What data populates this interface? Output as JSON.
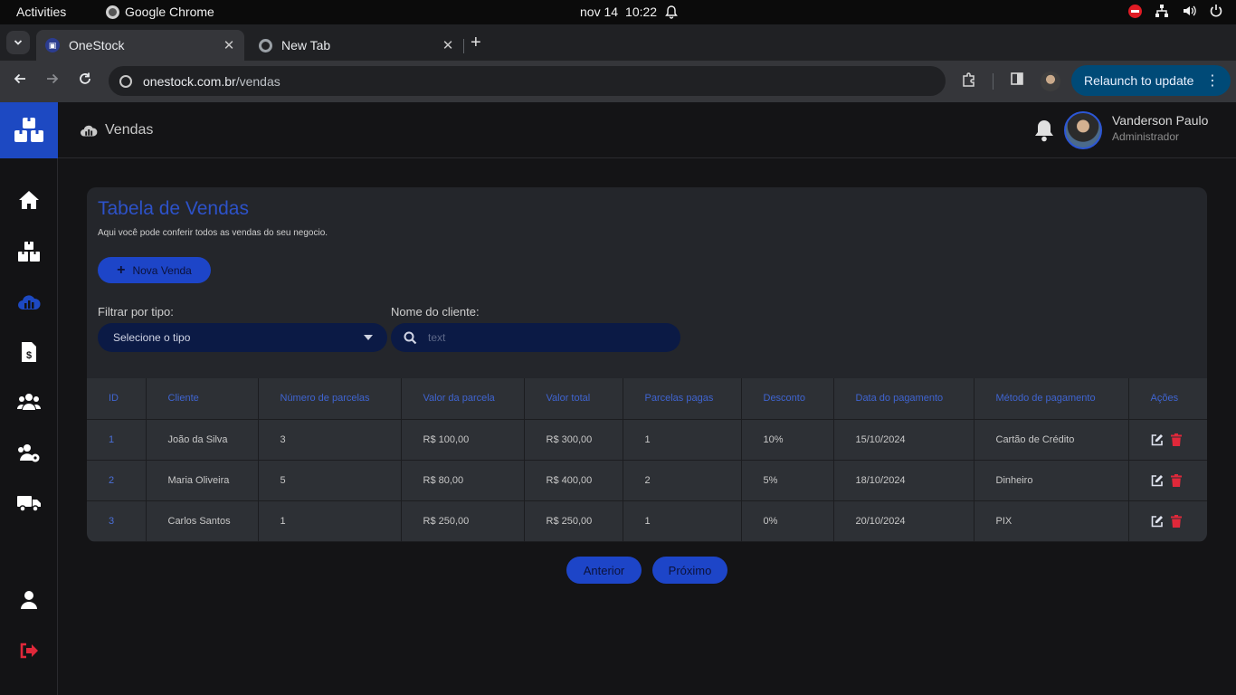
{
  "os_bar": {
    "activities": "Activities",
    "app_name": "Google Chrome",
    "date": "nov 14",
    "time": "10:22"
  },
  "browser": {
    "tabs": [
      {
        "title": "OneStock",
        "active": true
      },
      {
        "title": "New Tab",
        "active": false
      }
    ],
    "url_host": "onestock.com.br",
    "url_path": "/vendas",
    "relaunch_label": "Relaunch to update"
  },
  "header": {
    "section": "Vendas",
    "user_name": "Vanderson Paulo",
    "user_role": "Administrador"
  },
  "sidebar": {
    "items": [
      {
        "icon": "home-icon",
        "active": false
      },
      {
        "icon": "boxes-icon",
        "active": false
      },
      {
        "icon": "sales-chart-icon",
        "active": true
      },
      {
        "icon": "invoice-icon",
        "active": false
      },
      {
        "icon": "users-icon",
        "active": false
      },
      {
        "icon": "users-gear-icon",
        "active": false
      },
      {
        "icon": "truck-icon",
        "active": false
      },
      {
        "icon": "user-icon",
        "active": false
      },
      {
        "icon": "logout-icon",
        "active": false
      }
    ],
    "accent": "#1d49c2",
    "logout_color": "#e0283a"
  },
  "card": {
    "title": "Tabela de Vendas",
    "subtitle": "Aqui você pode conferir todos as vendas do seu negocio.",
    "new_button": "Nova Venda",
    "filter_type_label": "Filtrar por tipo:",
    "filter_type_value": "Selecione o tipo",
    "client_label": "Nome do cliente:",
    "client_placeholder": "text"
  },
  "table": {
    "headers": [
      "ID",
      "Cliente",
      "Número de parcelas",
      "Valor da parcela",
      "Valor total",
      "Parcelas pagas",
      "Desconto",
      "Data do pagamento",
      "Método de pagamento",
      "Ações"
    ],
    "rows": [
      [
        "1",
        "João da Silva",
        "3",
        "R$ 100,00",
        "R$ 300,00",
        "1",
        "10%",
        "15/10/2024",
        "Cartão de Crédito"
      ],
      [
        "2",
        "Maria Oliveira",
        "5",
        "R$ 80,00",
        "R$ 400,00",
        "2",
        "5%",
        "18/10/2024",
        "Dinheiro"
      ],
      [
        "3",
        "Carlos Santos",
        "1",
        "R$ 250,00",
        "R$ 250,00",
        "1",
        "0%",
        "20/10/2024",
        "PIX"
      ]
    ]
  },
  "pagination": {
    "prev": "Anterior",
    "next": "Próximo"
  }
}
